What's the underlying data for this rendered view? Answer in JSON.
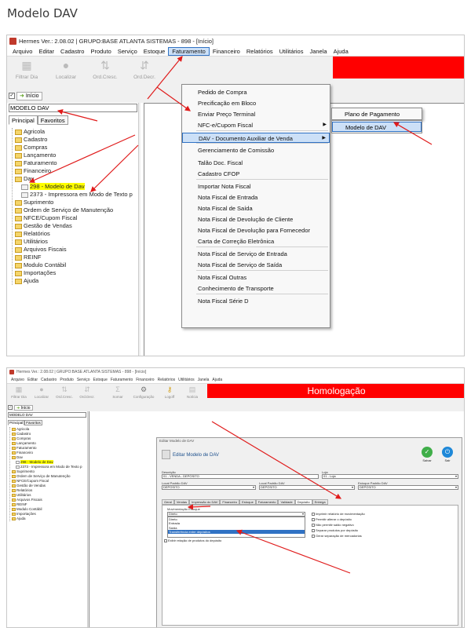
{
  "heading": "Modelo DAV",
  "shot1": {
    "title": "Hermes Ver.: 2.08.02 | GRUPO:BASE ATLANTA SISTEMAS - 898 - [Início]",
    "menu": [
      "Arquivo",
      "Editar",
      "Cadastro",
      "Produto",
      "Serviço",
      "Estoque",
      "Faturamento",
      "Financeiro",
      "Relatórios",
      "Utilitários",
      "Janela",
      "Ajuda"
    ],
    "toolbar": [
      "Filtrar Dia",
      "Localizar",
      "Ord.Cresc.",
      "Ord.Decr."
    ],
    "nav_tab": "Início",
    "search_value": "MODELO DAV",
    "tabs": [
      "Principal",
      "Favoritos"
    ],
    "tree": [
      {
        "label": "Agricola",
        "level": 1
      },
      {
        "label": "Cadastro",
        "level": 1
      },
      {
        "label": "Compras",
        "level": 1
      },
      {
        "label": "Lançamento",
        "level": 1
      },
      {
        "label": "Faturamento",
        "level": 1
      },
      {
        "label": "Financeiro",
        "level": 1
      },
      {
        "label": "Dav",
        "level": 1
      },
      {
        "label": "298 - Modelo de Dav",
        "level": 2,
        "highlight": true
      },
      {
        "label": "2373 - Impressora em Modo de Texto p",
        "level": 2
      },
      {
        "label": "Suprimento",
        "level": 1
      },
      {
        "label": "Ordem de Serviço de Manutenção",
        "level": 1
      },
      {
        "label": "NFCE/Cupom Fiscal",
        "level": 1
      },
      {
        "label": "Gestão de Vendas",
        "level": 1
      },
      {
        "label": "Relatórios",
        "level": 1
      },
      {
        "label": "Utilitários",
        "level": 1
      },
      {
        "label": "Arquivos Fiscais",
        "level": 1
      },
      {
        "label": "REINF",
        "level": 1
      },
      {
        "label": "Modulo Contábil",
        "level": 1
      },
      {
        "label": "Importações",
        "level": 1
      },
      {
        "label": "Ajuda",
        "level": 1
      }
    ],
    "faturamento_menu": [
      "Pedido de Compra",
      "Precificação em Bloco",
      "Enviar Preço Terminal",
      "NFC-e/Cupom Fiscal",
      "DAV - Documento Auxiliar de Venda",
      "Gerenciamento de Comissão",
      "Talão Doc. Fiscal",
      "Cadastro CFOP",
      "Importar Nota Fiscal",
      "Nota Fiscal de Entrada",
      "Nota Fiscal de Saída",
      "Nota Fiscal de Devolução de Cliente",
      "Nota Fiscal de Devolução para Fornecedor",
      "Carta de Correção Eletrônica",
      "Nota Fiscal de Serviço de Entrada",
      "Nota Fiscal de Serviço de Saída",
      "Nota Fiscal Outras",
      "Conhecimento de Transporte",
      "Nota Fiscal Série D"
    ],
    "dav_submenu": [
      "Plano de Pagamento",
      "Modelo de DAV"
    ]
  },
  "shot2": {
    "title": "Hermes Ver.: 2.08.02 | GRUPO:BASE ATLANTA SISTEMAS - 898 - [Início]",
    "menu": [
      "Arquivo",
      "Editar",
      "Cadastro",
      "Produto",
      "Serviço",
      "Estoque",
      "Faturamento",
      "Financeiro",
      "Relatórios",
      "Utilitários",
      "Janela",
      "Ajuda"
    ],
    "toolbar": [
      "Filtrar Dia",
      "Localizar",
      "Ord.Cresc.",
      "Ord.Decr.",
      "Somar",
      "Configuração",
      "Logoff",
      "Notícia"
    ],
    "banner": "Homologação",
    "nav_tab": "Início",
    "search_value": "MODELO DAV",
    "tabs": [
      "Principal",
      "Favoritos"
    ],
    "tree": [
      {
        "label": "Agricola",
        "level": 1
      },
      {
        "label": "Cadastro",
        "level": 1
      },
      {
        "label": "Compras",
        "level": 1
      },
      {
        "label": "Lançamento",
        "level": 1
      },
      {
        "label": "Faturamento",
        "level": 1
      },
      {
        "label": "Financeiro",
        "level": 1
      },
      {
        "label": "Dav",
        "level": 1
      },
      {
        "label": "298 - Modelo de Dav",
        "level": 2,
        "highlight": true
      },
      {
        "label": "2373 - Impressora em Modo de Texto p",
        "level": 2
      },
      {
        "label": "Suprimento",
        "level": 1
      },
      {
        "label": "Ordem de Serviço de Manutenção",
        "level": 1
      },
      {
        "label": "NFCE/Cupom Fiscal",
        "level": 1
      },
      {
        "label": "Gestão de Vendas",
        "level": 1
      },
      {
        "label": "Relatórios",
        "level": 1
      },
      {
        "label": "Utilitários",
        "level": 1
      },
      {
        "label": "Arquivos Fiscais",
        "level": 1
      },
      {
        "label": "REINF",
        "level": 1
      },
      {
        "label": "Modulo Contábil",
        "level": 1
      },
      {
        "label": "Importações",
        "level": 1
      },
      {
        "label": "Ajuda",
        "level": 1
      }
    ],
    "dialog": {
      "title": "Editar Modelo de DAV",
      "header": "Editar Modelo de DAV",
      "save": "Salvar",
      "exit": "Sair",
      "descricao_label": "Descrição",
      "descricao_value": "01 - VENDA - DEPÓSITO",
      "loja_label": "Loja",
      "loja_value": "01 - Loja",
      "local_saida_label": "Local Padrão DAV",
      "local_saida_value": "DEPÓSITO",
      "local_dav_label": "Local Padrão DAV",
      "local_dav_value": "DEPÓSITO",
      "estoque_label": "Estoque Padrão DAV",
      "estoque_value": "DEPÓSITO",
      "tabs": [
        "Geral",
        "Vendas",
        "Impressão do DAV",
        "Financeiro",
        "Estoque",
        "Faturamento",
        "Validade",
        "Depósito",
        "Entrega"
      ],
      "selected_tab": "Depósito",
      "field_label": "Movimentação Estoque",
      "combo_value": "Direto",
      "combo_options": [
        "Direto",
        "Entrada",
        "Saída",
        "Transferência entre depósitos"
      ],
      "checkboxes": [
        "Imprimir relatório de movimentação",
        "Permitir alterar o depósito",
        "Não permitir saldo negativo",
        "Separar produtos por depósito",
        "Gerar separação de mercadorias"
      ],
      "bottom_check": "Exibir relação de produtos do depósito"
    }
  }
}
